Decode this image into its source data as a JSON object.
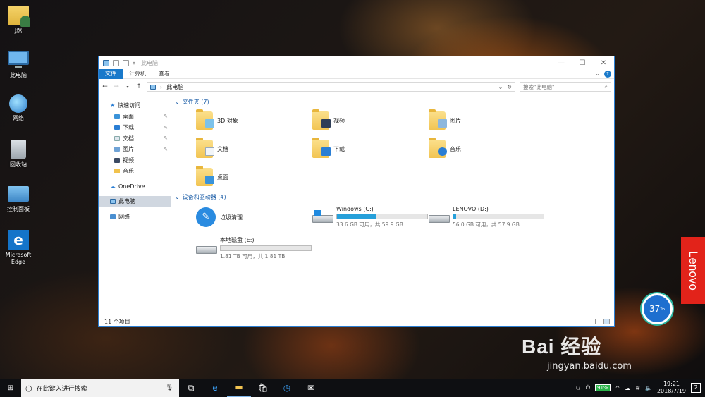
{
  "desktop": {
    "icons": [
      {
        "label": "J然",
        "name": "user-folder"
      },
      {
        "label": "此电脑",
        "name": "this-pc"
      },
      {
        "label": "网络",
        "name": "network"
      },
      {
        "label": "回收站",
        "name": "recycle-bin"
      },
      {
        "label": "控制面板",
        "name": "control-panel"
      },
      {
        "label": "Microsoft Edge",
        "name": "edge"
      }
    ],
    "lenovo_badge": "Lenovo",
    "meter": {
      "value": "37",
      "unit": "%"
    },
    "watermark": {
      "line1": "Bai 经验",
      "line2": "jingyan.baidu.com"
    }
  },
  "window": {
    "title": "此电脑",
    "controls": {
      "minimize": "—",
      "maximize": "☐",
      "close": "✕"
    },
    "ribbon_tabs": [
      "文件",
      "计算机",
      "查看"
    ],
    "address": "此电脑",
    "search_placeholder": "搜索\"此电脑\"",
    "nav": {
      "quick_access": "快速访问",
      "quick_items": [
        "桌面",
        "下载",
        "文档",
        "图片",
        "视频",
        "音乐"
      ],
      "onedrive": "OneDrive",
      "this_pc": "此电脑",
      "network": "网络"
    },
    "folders_header": "文件夹 (7)",
    "folders": [
      "3D 对象",
      "视频",
      "图片",
      "文档",
      "下载",
      "音乐",
      "桌面"
    ],
    "devices_header": "设备和驱动器 (4)",
    "devices": [
      {
        "name": "垃圾清理",
        "free": "",
        "fill": null
      },
      {
        "name": "Windows (C:)",
        "free": "33.6 GB 可用，共 59.9 GB",
        "fill": 0.44
      },
      {
        "name": "LENOVO (D:)",
        "free": "56.0 GB 可用，共 57.9 GB",
        "fill": 0.03
      },
      {
        "name": "本地磁盘 (E:)",
        "free": "1.81 TB 可用，共 1.81 TB",
        "fill": 0.0
      }
    ],
    "status": "11 个项目"
  },
  "taskbar": {
    "search_placeholder": "在此键入进行搜索",
    "battery": "91%",
    "time": "19:21",
    "date": "2018/7/19",
    "notifications": "2"
  },
  "colors": {
    "accent": "#1979ca",
    "drive_fill": "#26a0da",
    "lenovo": "#e2231a"
  }
}
